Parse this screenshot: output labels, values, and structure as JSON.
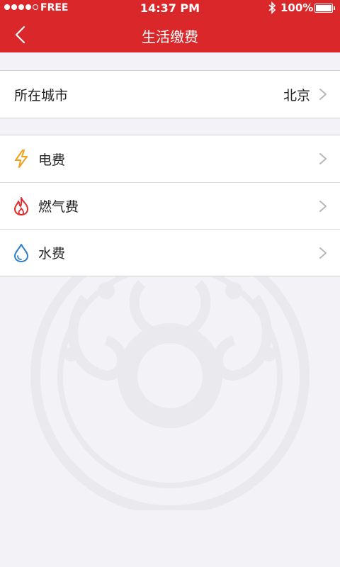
{
  "status_bar": {
    "carrier": "FREE",
    "time": "14:37 PM",
    "battery": "100%"
  },
  "header": {
    "title": "生活缴费"
  },
  "city_row": {
    "label": "所在城市",
    "value": "北京"
  },
  "bill_items": [
    {
      "label": "电费",
      "icon": "lightning-icon",
      "color": "#f0a21a"
    },
    {
      "label": "燃气费",
      "icon": "flame-icon",
      "color": "#e32a2a"
    },
    {
      "label": "水费",
      "icon": "water-drop-icon",
      "color": "#2f7fc9"
    }
  ],
  "colors": {
    "brand": "#d9272a",
    "background": "#f3f3f7"
  }
}
